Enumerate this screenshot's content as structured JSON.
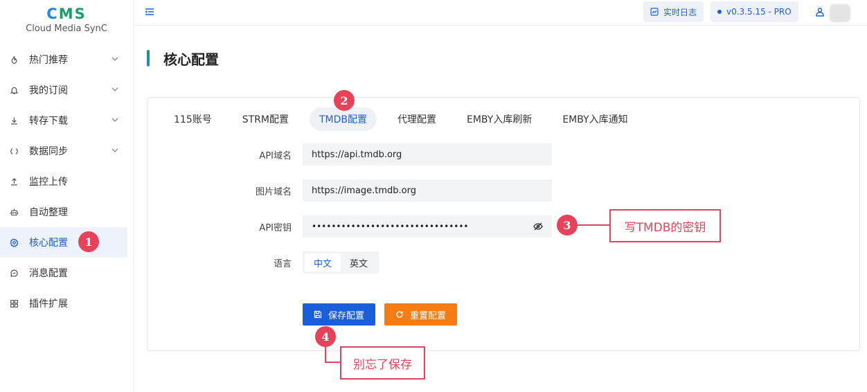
{
  "logo": {
    "title_c": "C",
    "title_rest": "MS",
    "subtitle": "Cloud Media SynC"
  },
  "sidebar": {
    "items": [
      {
        "label": "热门推荐",
        "icon": "flame-icon",
        "has_chevron": true
      },
      {
        "label": "我的订阅",
        "icon": "bell-icon",
        "has_chevron": true
      },
      {
        "label": "转存下载",
        "icon": "download-icon",
        "has_chevron": true
      },
      {
        "label": "数据同步",
        "icon": "sync-icon",
        "has_chevron": true
      },
      {
        "label": "监控上传",
        "icon": "upload-icon",
        "has_chevron": false
      },
      {
        "label": "自动整理",
        "icon": "robot-icon",
        "has_chevron": false
      },
      {
        "label": "核心配置",
        "icon": "gear-icon",
        "has_chevron": false,
        "active": true
      },
      {
        "label": "消息配置",
        "icon": "chat-icon",
        "has_chevron": false
      },
      {
        "label": "插件扩展",
        "icon": "grid-icon",
        "has_chevron": false
      }
    ]
  },
  "header": {
    "log_button": "实时日志",
    "version": "v0.3.5.15 - PRO"
  },
  "page": {
    "title": "核心配置"
  },
  "tabs": [
    "115账号",
    "STRM配置",
    "TMDB配置",
    "代理配置",
    "EMBY入库刷新",
    "EMBY入库通知"
  ],
  "active_tab": "TMDB配置",
  "form": {
    "api_domain_label": "API域名",
    "api_domain_value": "https://api.tmdb.org",
    "image_domain_label": "图片域名",
    "image_domain_value": "https://image.tmdb.org",
    "api_key_label": "API密钥",
    "api_key_value": "••••••••••••••••••••••••••••••••",
    "language_label": "语言",
    "language_options": [
      "中文",
      "英文"
    ],
    "language_selected": "中文"
  },
  "buttons": {
    "save": "保存配置",
    "reset": "重置配置"
  },
  "annotations": {
    "badges": [
      "1",
      "2",
      "3",
      "4"
    ],
    "callout_key": "写TMDB的密钥",
    "callout_save": "别忘了保存"
  },
  "colors": {
    "primary": "#1a5fd9",
    "accent_green": "#16a06a",
    "reset_orange": "#f57c12",
    "marker_red": "#e8425a"
  }
}
